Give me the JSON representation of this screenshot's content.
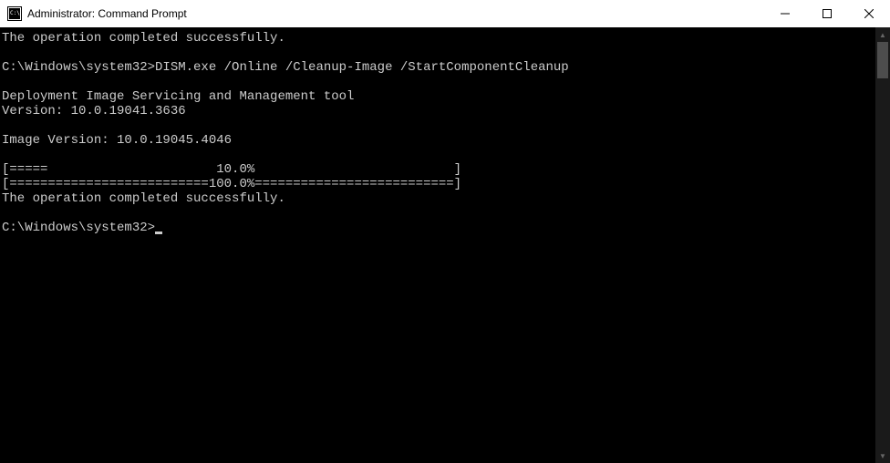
{
  "window": {
    "title": "Administrator: Command Prompt"
  },
  "terminal": {
    "lines": [
      "The operation completed successfully.",
      "",
      "C:\\Windows\\system32>DISM.exe /Online /Cleanup-Image /StartComponentCleanup",
      "",
      "Deployment Image Servicing and Management tool",
      "Version: 10.0.19041.3636",
      "",
      "Image Version: 10.0.19045.4046",
      "",
      "[=====                      10.0%                          ]",
      "[==========================100.0%==========================]",
      "The operation completed successfully.",
      "",
      "C:\\Windows\\system32>"
    ],
    "current_prompt": "C:\\Windows\\system32>"
  }
}
